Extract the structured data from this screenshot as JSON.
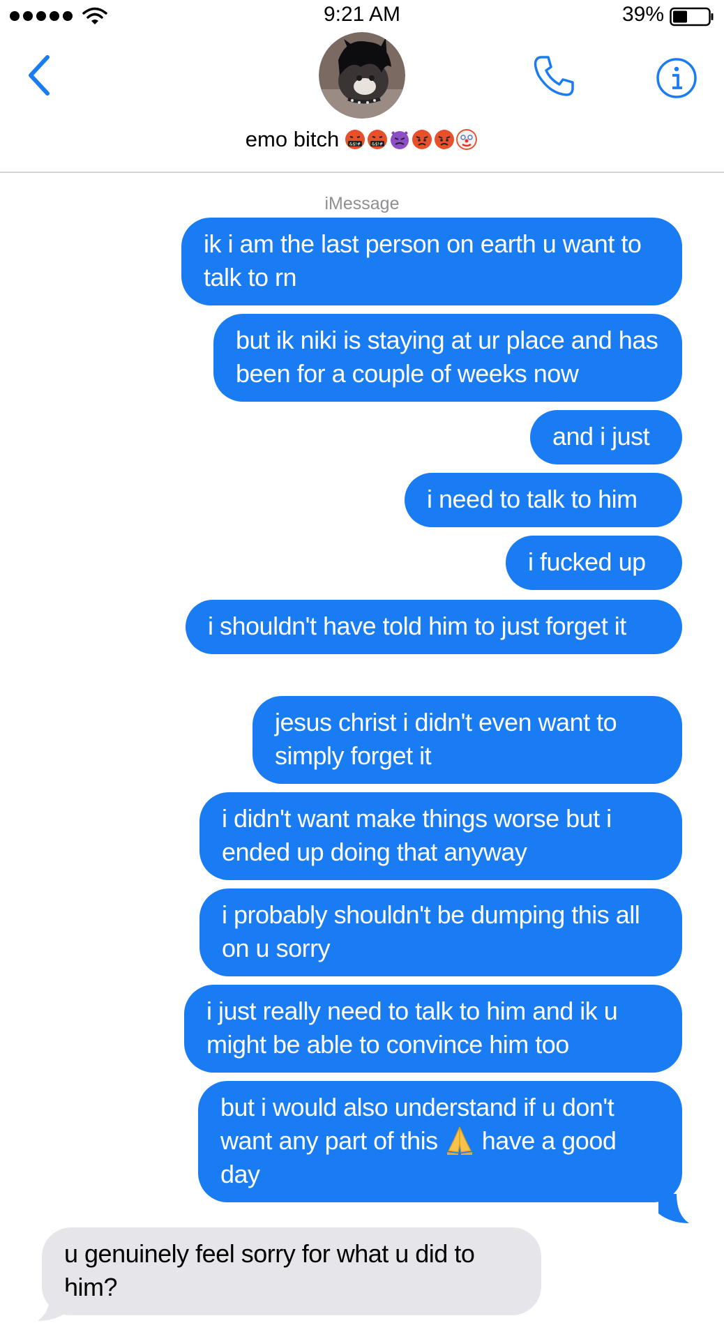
{
  "status_bar": {
    "time": "9:21 AM",
    "battery_percent": "39%",
    "signal_icon": "signal-dots-icon",
    "wifi_icon": "wifi-icon",
    "battery_icon": "battery-icon"
  },
  "header": {
    "contact_name": "emo bitch",
    "name_emojis": [
      "cursing-face",
      "cursing-face",
      "angry-devil",
      "angry-face",
      "angry-face",
      "clown-face"
    ],
    "back_icon": "chevron-left-icon",
    "call_icon": "phone-icon",
    "info_icon": "info-icon"
  },
  "thread": {
    "service_label": "iMessage",
    "messages": [
      {
        "direction": "sent",
        "text": "ik i am the last person on earth u want to talk to rn"
      },
      {
        "direction": "sent",
        "text": "but ik niki is staying at ur place and has been for a couple of weeks now"
      },
      {
        "direction": "sent",
        "text": "and i just"
      },
      {
        "direction": "sent",
        "text": "i need to talk to him"
      },
      {
        "direction": "sent",
        "text": "i fucked up"
      },
      {
        "direction": "sent",
        "text": "i shouldn't have told him to just forget it"
      },
      {
        "direction": "sent",
        "text": "jesus christ i didn't even want to simply forget it"
      },
      {
        "direction": "sent",
        "text": "i didn't want make things worse but i ended up doing that anyway"
      },
      {
        "direction": "sent",
        "text": "i probably shouldn't be dumping this all on u sorry"
      },
      {
        "direction": "sent",
        "text": "i just really need to talk to him and ik u might be able to convince him too"
      },
      {
        "direction": "sent",
        "text_before_emoji": "but i would also understand if u don't want any part of this",
        "emoji": "folded-hands",
        "text_after_emoji": " have a good day"
      },
      {
        "direction": "received",
        "text": "u genuinely feel sorry for what u did to him?"
      }
    ]
  },
  "colors": {
    "sent_bubble": "#1a7cf3",
    "received_bubble": "#e5e5ea",
    "accent": "#1a7cf3"
  }
}
